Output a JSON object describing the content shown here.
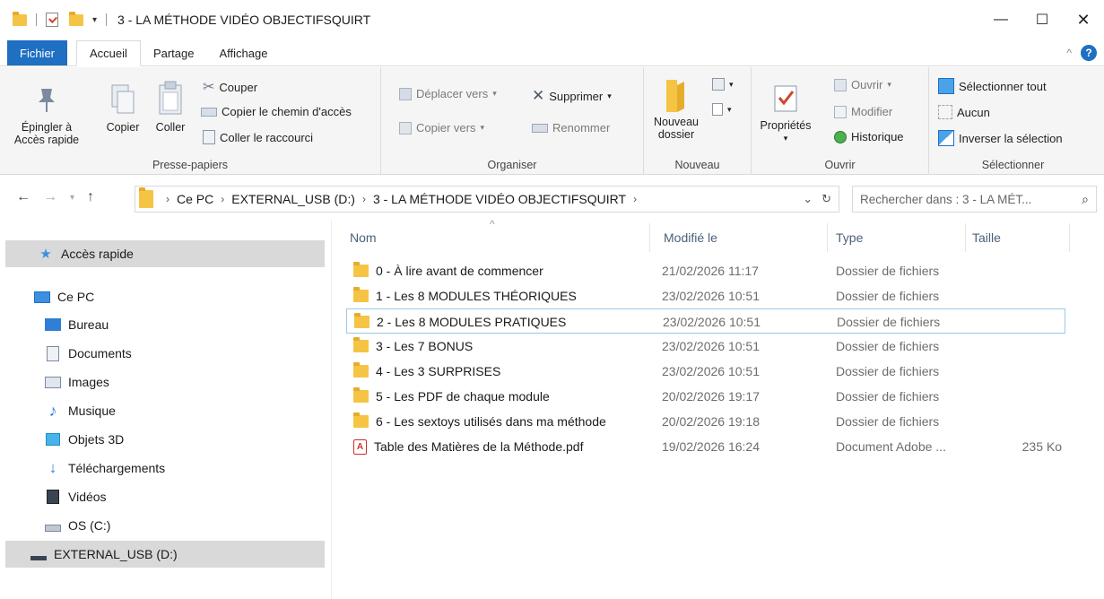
{
  "window": {
    "title": "3 - LA MÉTHODE VIDÉO OBJECTIFSQUIRT",
    "minimize": "—",
    "maximize": "☐",
    "close": "✕"
  },
  "ribbon_tabs": [
    "Fichier",
    "Accueil",
    "Partage",
    "Affichage"
  ],
  "ribbon": {
    "presse_papiers": {
      "label": "Presse-papiers",
      "pin": "Épingler à\nAccès rapide",
      "pin_l1": "Épingler à",
      "pin_l2": "Accès rapide",
      "copy": "Copier",
      "paste": "Coller",
      "cut": "Couper",
      "copy_path": "Copier le chemin d'accès",
      "paste_shortcut": "Coller le raccourci"
    },
    "organiser": {
      "label": "Organiser",
      "move_to": "Déplacer vers",
      "copy_to": "Copier vers",
      "delete": "Supprimer",
      "rename": "Renommer"
    },
    "nouveau": {
      "label": "Nouveau",
      "new_folder_l1": "Nouveau",
      "new_folder_l2": "dossier"
    },
    "ouvrir": {
      "label": "Ouvrir",
      "properties": "Propriétés",
      "open": "Ouvrir",
      "edit": "Modifier",
      "history": "Historique"
    },
    "selectionner": {
      "label": "Sélectionner",
      "select_all": "Sélectionner tout",
      "none": "Aucun",
      "invert": "Inverser la sélection"
    }
  },
  "address": {
    "crumbs": [
      "Ce PC",
      "EXTERNAL_USB (D:)",
      "3 - LA MÉTHODE VIDÉO OBJECTIFSQUIRT"
    ],
    "search_placeholder": "Rechercher dans : 3 - LA MÉT..."
  },
  "nav_pane": [
    {
      "label": "Accès rapide",
      "icon": "star-icon",
      "selected": true
    },
    {
      "label": "Ce PC",
      "icon": "computer-icon",
      "selected": false
    },
    {
      "label": "Bureau",
      "icon": "desktop-icon",
      "selected": false
    },
    {
      "label": "Documents",
      "icon": "documents-icon",
      "selected": false
    },
    {
      "label": "Images",
      "icon": "images-icon",
      "selected": false
    },
    {
      "label": "Musique",
      "icon": "music-icon",
      "selected": false
    },
    {
      "label": "Objets 3D",
      "icon": "objects3d-icon",
      "selected": false
    },
    {
      "label": "Téléchargements",
      "icon": "downloads-icon",
      "selected": false
    },
    {
      "label": "Vidéos",
      "icon": "videos-icon",
      "selected": false
    },
    {
      "label": "OS (C:)",
      "icon": "drive-icon",
      "selected": false
    },
    {
      "label": "EXTERNAL_USB (D:)",
      "icon": "usb-drive-icon",
      "selected": true
    }
  ],
  "columns": {
    "name": "Nom",
    "modified": "Modifié le",
    "type": "Type",
    "size": "Taille"
  },
  "files": [
    {
      "name": "0 - À lire avant de commencer",
      "modified": "21/02/2026 11:17",
      "type": "Dossier de fichiers",
      "size": "",
      "kind": "folder"
    },
    {
      "name": "1 - Les 8 MODULES THÉORIQUES",
      "modified": "23/02/2026 10:51",
      "type": "Dossier de fichiers",
      "size": "",
      "kind": "folder"
    },
    {
      "name": "2 - Les 8 MODULES PRATIQUES",
      "modified": "23/02/2026 10:51",
      "type": "Dossier de fichiers",
      "size": "",
      "kind": "folder"
    },
    {
      "name": "3 - Les 7 BONUS",
      "modified": "23/02/2026 10:51",
      "type": "Dossier de fichiers",
      "size": "",
      "kind": "folder"
    },
    {
      "name": "4 - Les 3 SURPRISES",
      "modified": "23/02/2026 10:51",
      "type": "Dossier de fichiers",
      "size": "",
      "kind": "folder"
    },
    {
      "name": "5 - Les PDF de chaque module",
      "modified": "20/02/2026 19:17",
      "type": "Dossier de fichiers",
      "size": "",
      "kind": "folder"
    },
    {
      "name": "6 - Les sextoys utilisés dans ma méthode",
      "modified": "20/02/2026 19:18",
      "type": "Dossier de fichiers",
      "size": "",
      "kind": "folder"
    },
    {
      "name": "Table des Matières de la Méthode.pdf",
      "modified": "19/02/2026 16:24",
      "type": "Document Adobe ...",
      "size": "235 Ko",
      "kind": "pdf"
    }
  ],
  "colors": {
    "accent": "#1f6fc2",
    "folder": "#f6c444",
    "selected_bg": "#d9d9d9",
    "focus_border": "#99c9e8"
  }
}
